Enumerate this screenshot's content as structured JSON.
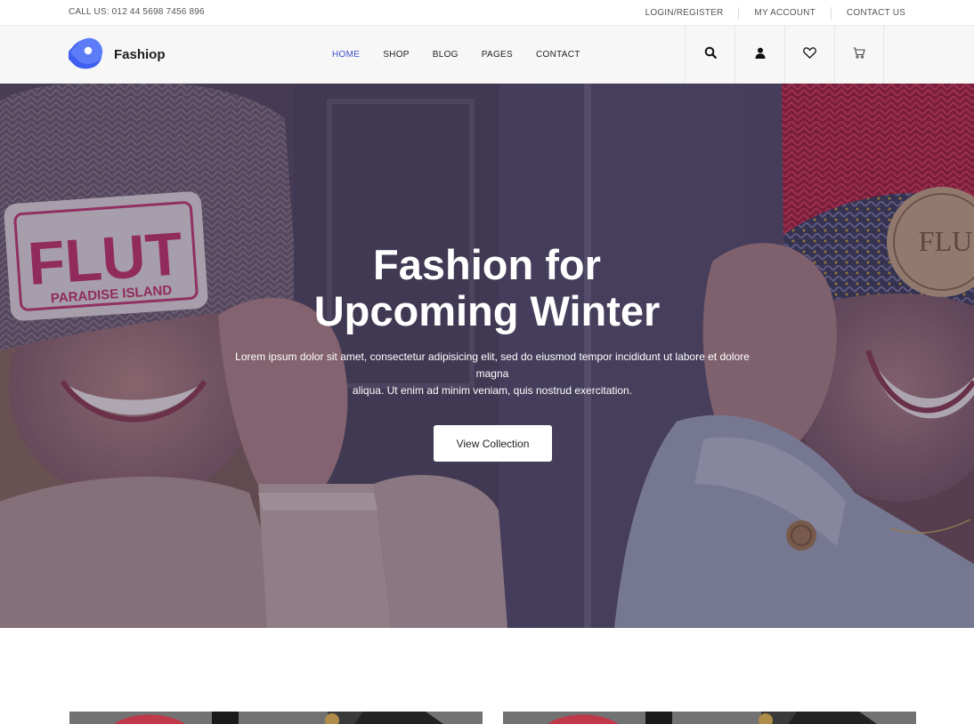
{
  "topbar": {
    "call": "CALL US: 012 44 5698 7456 896",
    "links": [
      "LOGIN/REGISTER",
      "MY ACCOUNT",
      "CONTACT US"
    ]
  },
  "header": {
    "brand": "Fashiop",
    "nav": [
      "HOME",
      "SHOP",
      "BLOG",
      "PAGES",
      "CONTACT"
    ],
    "active_nav": "HOME"
  },
  "hero": {
    "title_line1": "Fashion for",
    "title_line2": "Upcoming Winter",
    "subtitle_line1": "Lorem ipsum dolor sit amet, consectetur adipisicing elit, sed do eiusmod tempor incididunt ut labore et dolore magna",
    "subtitle_line2": "aliqua. Ut enim ad minim veniam, quis nostrud exercitation.",
    "button": "View Collection",
    "photo_hat_left_text": "FLUT",
    "photo_hat_left_subtext": "PARADISE ISLAND",
    "photo_hat_right_text": "FLU"
  },
  "icons": [
    "search-icon",
    "user-icon",
    "heart-icon",
    "cart-icon"
  ],
  "colors": {
    "accent": "#3f4fd1",
    "logo": "#4a6cf0"
  }
}
